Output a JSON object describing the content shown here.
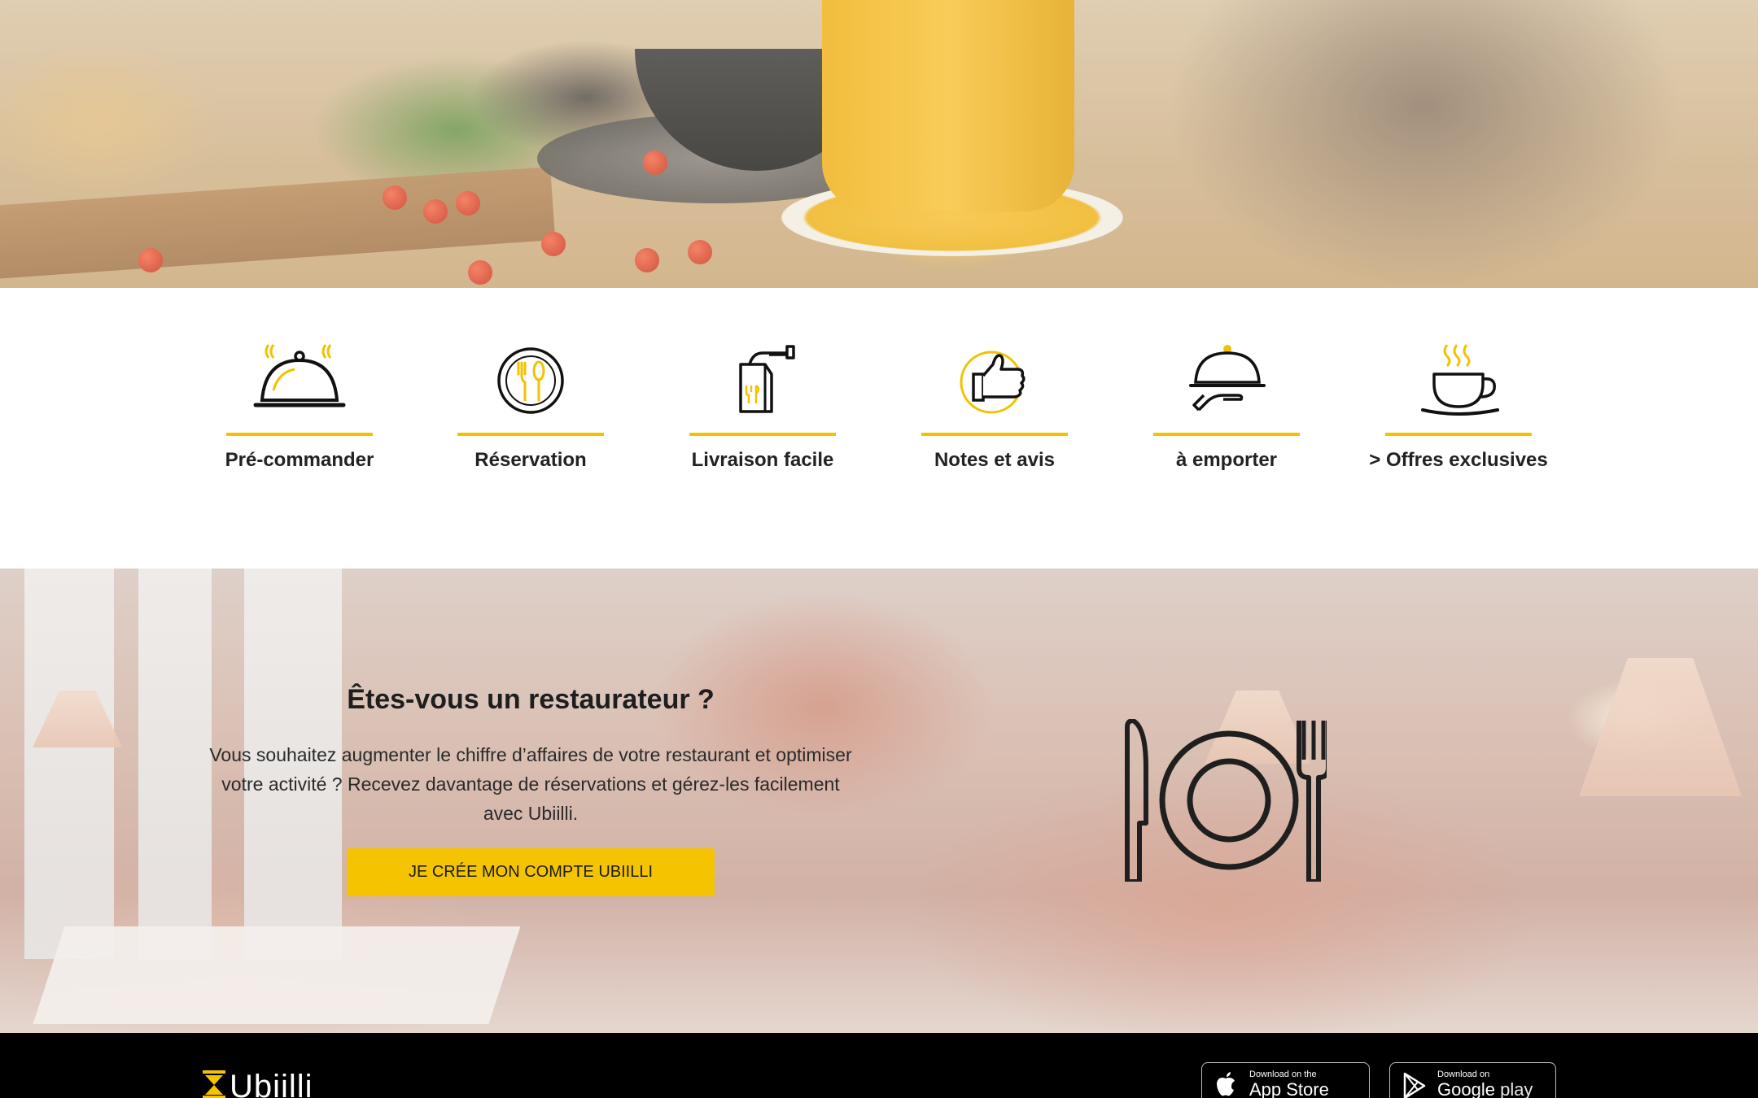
{
  "colors": {
    "accent": "#f5c400",
    "footer_bg": "#000000",
    "text": "#222222"
  },
  "features": [
    {
      "label": "Pré-commander",
      "icon": "cloche-icon"
    },
    {
      "label": "Réservation",
      "icon": "plate-cutlery-icon"
    },
    {
      "label": "Livraison facile",
      "icon": "delivery-bag-icon"
    },
    {
      "label": "Notes et avis",
      "icon": "thumbs-up-icon"
    },
    {
      "label": "à emporter",
      "icon": "serving-hand-icon"
    },
    {
      "label": "> Offres exclusives",
      "icon": "coffee-cup-icon"
    }
  ],
  "restaurateur": {
    "title": "Êtes-vous un restaurateur ?",
    "text": "Vous souhaitez augmenter le chiffre d’affaires de votre restaurant et optimiser votre activité ? Recevez davantage de réservations et gérez-les facilement avec Ubiilli.",
    "cta": "JE CRÉE MON COMPTE UBIILLI",
    "icon": "knife-plate-fork-icon"
  },
  "footer": {
    "logo": "Ubiilli",
    "app_store": {
      "small": "Download on the",
      "big": "App Store"
    },
    "google_play": {
      "small": "Download on",
      "big_1": "Google",
      "big_2": "play"
    }
  }
}
